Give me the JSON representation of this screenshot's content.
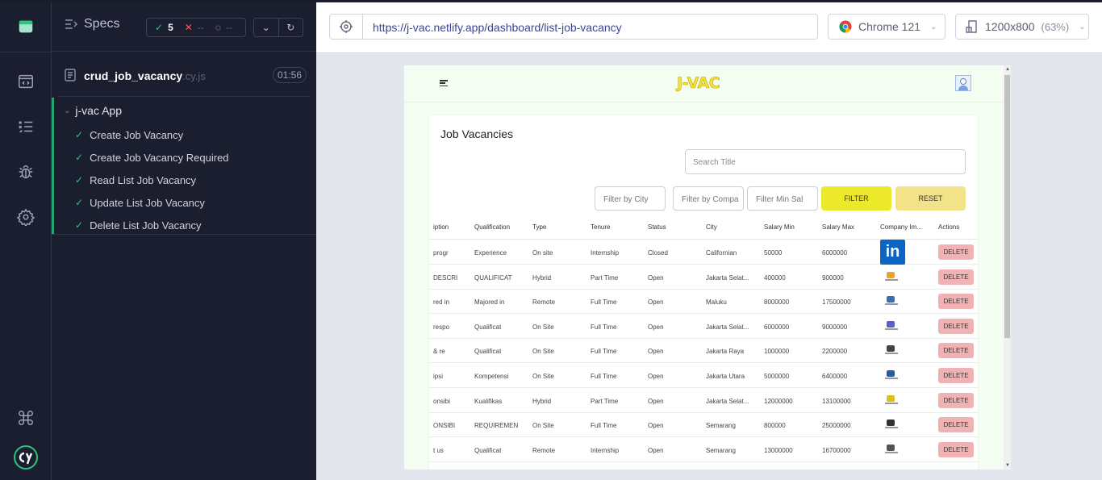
{
  "specs": {
    "title": "Specs",
    "passed": "5",
    "failed": "--",
    "pending": "--",
    "file_name": "crud_job_vacancy",
    "file_ext": ".cy.js",
    "duration": "01:56",
    "suite": "j-vac App",
    "tests": [
      "Create Job Vacancy",
      "Create Job Vacancy Required",
      "Read List Job Vacancy",
      "Update List Job Vacancy",
      "Delete List Job Vacancy"
    ]
  },
  "browser": {
    "url": "https://j-vac.netlify.app/dashboard/list-job-vacancy",
    "name": "Chrome 121",
    "viewport": "1200x800",
    "zoom": "(63%)"
  },
  "app": {
    "logo": "J-VAC",
    "card_title": "Job Vacancies",
    "search_placeholder": "Search Title",
    "filter_city": "Filter by City",
    "filter_company": "Filter by Compa",
    "filter_salary": "Filter Min Sal",
    "filter_label": "FILTER",
    "reset_label": "RESET",
    "delete_label": "DELETE",
    "columns": [
      "iption",
      "Qualification",
      "Type",
      "Tenure",
      "Status",
      "City",
      "Salary Min",
      "Salary Max",
      "Company Im...",
      "Actions"
    ],
    "rows": [
      [
        "progr",
        "Experience",
        "On site",
        "Internship",
        "Closed",
        "Californian",
        "50000",
        "6000000"
      ],
      [
        "DESCRI",
        "QUALIFICAT",
        "Hybrid",
        "Part Time",
        "Open",
        "Jakarta Selat...",
        "400000",
        "900000"
      ],
      [
        "red in",
        "Majored in",
        "Remote",
        "Full Time",
        "Open",
        "Maluku",
        "8000000",
        "17500000"
      ],
      [
        "respo",
        "Qualificat",
        "On Site",
        "Full Time",
        "Open",
        "Jakarta Selat...",
        "6000000",
        "9000000"
      ],
      [
        "& re",
        "Qualificat",
        "On Site",
        "Full Time",
        "Open",
        "Jakarta Raya",
        "1000000",
        "2200000"
      ],
      [
        "ipsi",
        "Kompetensi",
        "On Site",
        "Full Time",
        "Open",
        "Jakarta Utara",
        "5000000",
        "6400000"
      ],
      [
        "onsibi",
        "Kualifikas",
        "Hybrid",
        "Part Time",
        "Open",
        "Jakarta Selat...",
        "12000000",
        "13100000"
      ],
      [
        "ONSIBI",
        "REQUIREMEN",
        "On Site",
        "Full Time",
        "Open",
        "Semarang",
        "800000",
        "25000000"
      ],
      [
        "t us",
        "Qualificat",
        "Remote",
        "Internship",
        "Open",
        "Semarang",
        "13000000",
        "16700000"
      ]
    ],
    "company_logos": [
      "linkedin-logo",
      "company-logo",
      "company-logo",
      "company-logo",
      "company-logo",
      "company-logo",
      "company-logo",
      "company-logo",
      "company-logo"
    ],
    "linkedin_text": "in"
  },
  "colors": {
    "accent_green": "#2ec27e",
    "fail_red": "#f35a6a",
    "filter_yellow": "#ece92b",
    "reset_yellow": "#f2e388",
    "delete_pink": "#f0b2b2"
  }
}
